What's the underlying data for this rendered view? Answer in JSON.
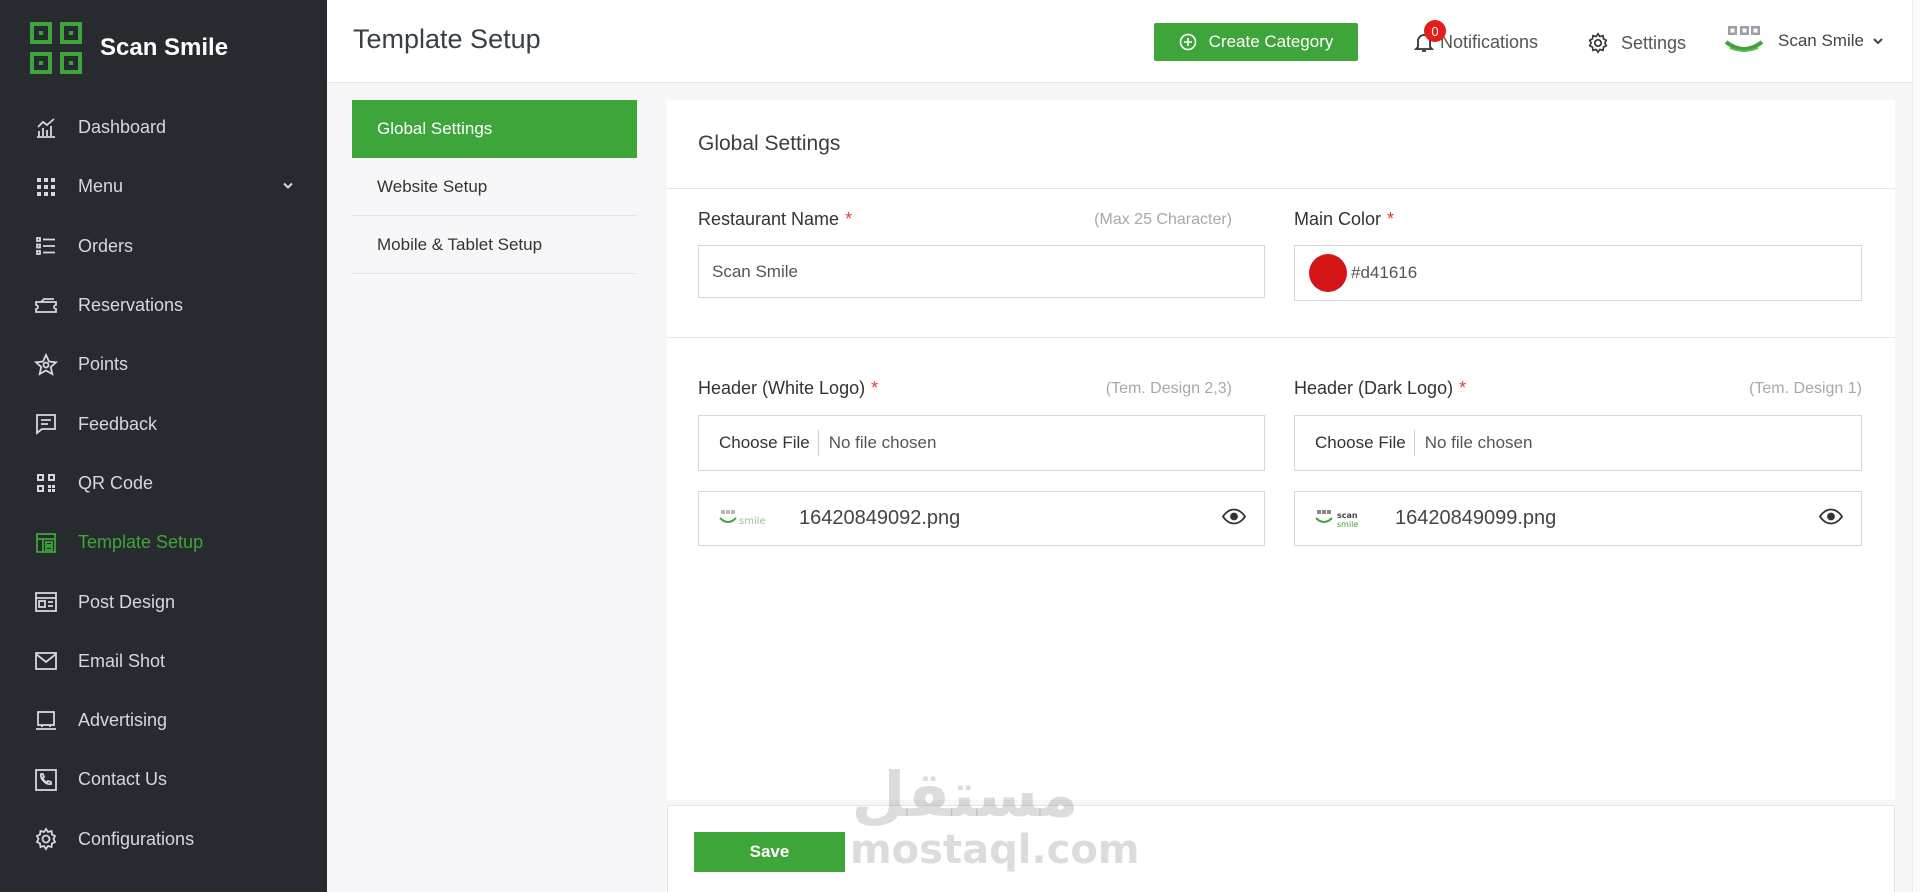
{
  "brand": {
    "name": "Scan Smile"
  },
  "sidebar": {
    "items": [
      {
        "label": "Dashboard",
        "icon": "chart-icon"
      },
      {
        "label": "Menu",
        "icon": "grid-icon"
      },
      {
        "label": "Orders",
        "icon": "list-icon"
      },
      {
        "label": "Reservations",
        "icon": "ticket-icon"
      },
      {
        "label": "Points",
        "icon": "star-icon"
      },
      {
        "label": "Feedback",
        "icon": "message-icon"
      },
      {
        "label": "QR Code",
        "icon": "qr-icon"
      },
      {
        "label": "Template Setup",
        "icon": "template-icon"
      },
      {
        "label": "Post Design",
        "icon": "layout-icon"
      },
      {
        "label": "Email Shot",
        "icon": "mail-icon"
      },
      {
        "label": "Advertising",
        "icon": "laptop-icon"
      },
      {
        "label": "Contact Us",
        "icon": "phone-icon"
      },
      {
        "label": "Configurations",
        "icon": "gear-icon"
      }
    ],
    "active": "Template Setup"
  },
  "header": {
    "title": "Template Setup",
    "create_label": "Create Category",
    "notifications_label": "Notifications",
    "notifications_count": "0",
    "settings_label": "Settings",
    "user_name": "Scan Smile"
  },
  "subnav": {
    "items": [
      "Global Settings",
      "Website Setup",
      "Mobile & Tablet Setup"
    ]
  },
  "form": {
    "title": "Global Settings",
    "restaurant_name": {
      "label": "Restaurant Name",
      "required": "*",
      "hint": "(Max 25 Character)",
      "value": "Scan Smile"
    },
    "main_color": {
      "label": "Main Color",
      "required": "*",
      "value": "#d41616"
    },
    "white_logo": {
      "label": "Header (White Logo)",
      "required": "*",
      "hint": "(Tem. Design 2,3)",
      "choose": "Choose File",
      "status": "No file chosen",
      "file": "16420849092.png"
    },
    "dark_logo": {
      "label": "Header (Dark Logo)",
      "required": "*",
      "hint": "(Tem. Design 1)",
      "choose": "Choose File",
      "status": "No file chosen",
      "file": "16420849099.png"
    },
    "save_label": "Save"
  },
  "watermark": {
    "arabic": "مستقل",
    "latin": "mostaql.com"
  },
  "colors": {
    "accent": "#3ea53a",
    "sidebar": "#272b30",
    "badge": "#e51d1d"
  }
}
